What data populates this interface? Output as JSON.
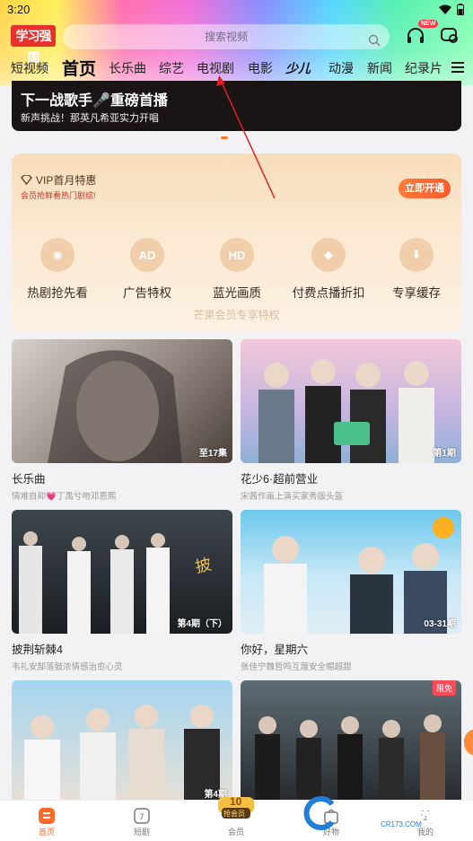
{
  "status": {
    "time": "3:20"
  },
  "header": {
    "logo": "学习强国",
    "search_placeholder": "搜索视频",
    "new_badge": "NEW"
  },
  "nav": {
    "tabs": [
      "短视频",
      "首页",
      "长乐曲",
      "综艺",
      "电视剧",
      "电影",
      "少儿",
      "动漫",
      "新闻",
      "纪录片"
    ],
    "active": "首页"
  },
  "banner": {
    "title": "下一战歌手🎤重磅首播",
    "subtitle": "新声挑战！那英凡希亚实力开唱"
  },
  "vip": {
    "title": "VIP首月特惠",
    "subtitle": "会员抢鲜看热门剧综!",
    "button": "立即开通",
    "perks": [
      {
        "icon": "sofa-icon",
        "label": "热剧抢先看",
        "glyph": "◉"
      },
      {
        "icon": "ad-icon",
        "label": "广告特权",
        "glyph": "AD"
      },
      {
        "icon": "hd-icon",
        "label": "蓝光画质",
        "glyph": "HD"
      },
      {
        "icon": "tag-icon",
        "label": "付费点播折扣",
        "glyph": "◆"
      },
      {
        "icon": "download-icon",
        "label": "专享缓存",
        "glyph": "⬇"
      }
    ],
    "footer": "芒果会员专享特权"
  },
  "cards": [
    {
      "title": "长乐曲",
      "sub": "情难自抑💗丁禹兮吻邓恩熙",
      "badge": "至17集",
      "colors": [
        "#c9c4c0",
        "#6e6462"
      ]
    },
    {
      "title": "花少6·超前营业",
      "sub": "宋茜作画上演买家秀版头盔",
      "badge": "第1期",
      "colors": [
        "#eac0d2",
        "#8fa6c8"
      ]
    },
    {
      "title": "披荆斩棘4",
      "sub": "韦礼安郜落鼓浓情感治愈心灵",
      "badge": "第4期（下）",
      "colors": [
        "#3a4046",
        "#161a1e"
      ]
    },
    {
      "title": "你好，星期六",
      "sub": "张佳宁魏哲鸣互蔑安全帽超甜",
      "badge": "03-31期",
      "colors": [
        "#7fd0f0",
        "#cfe9f6"
      ]
    },
    {
      "title": "",
      "sub": "",
      "badge": "第4期",
      "colors": [
        "#a8d8f2",
        "#e8e0d8"
      ]
    },
    {
      "title": "",
      "sub": "",
      "badge": "",
      "free": "限免",
      "colors": [
        "#5c6a72",
        "#2c3236"
      ]
    }
  ],
  "bottom_nav": [
    {
      "label": "首页",
      "icon": "home-icon"
    },
    {
      "label": "短剧",
      "icon": "shortplay-icon"
    },
    {
      "label": "会员",
      "icon": "vip-icon"
    },
    {
      "label": "好物",
      "icon": "shop-icon"
    },
    {
      "label": "我的",
      "icon": "profile-icon"
    }
  ],
  "vip_center": {
    "top": "10",
    "bottom": "抢会员"
  },
  "watermark": {
    "name": "西西软件园",
    "url": "CR173.COM"
  },
  "colors": {
    "accent": "#ff6a2a",
    "vip_button": "#ff5a2a",
    "logo_red": "#e8312b"
  }
}
